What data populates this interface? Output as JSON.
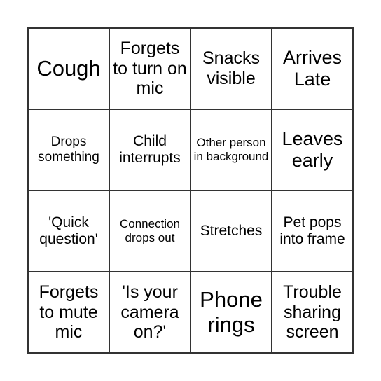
{
  "board": {
    "cells": [
      "Cough",
      "Forgets to turn on mic",
      "Snacks visible",
      "Arrives Late",
      "Drops something",
      "Child interrupts",
      "Other person in background",
      "Leaves early",
      "'Quick question'",
      "Connection drops out",
      "Stretches",
      "Pet pops into frame",
      "Forgets to mute mic",
      "'Is your camera on?'",
      "Phone rings",
      "Trouble sharing screen"
    ]
  }
}
